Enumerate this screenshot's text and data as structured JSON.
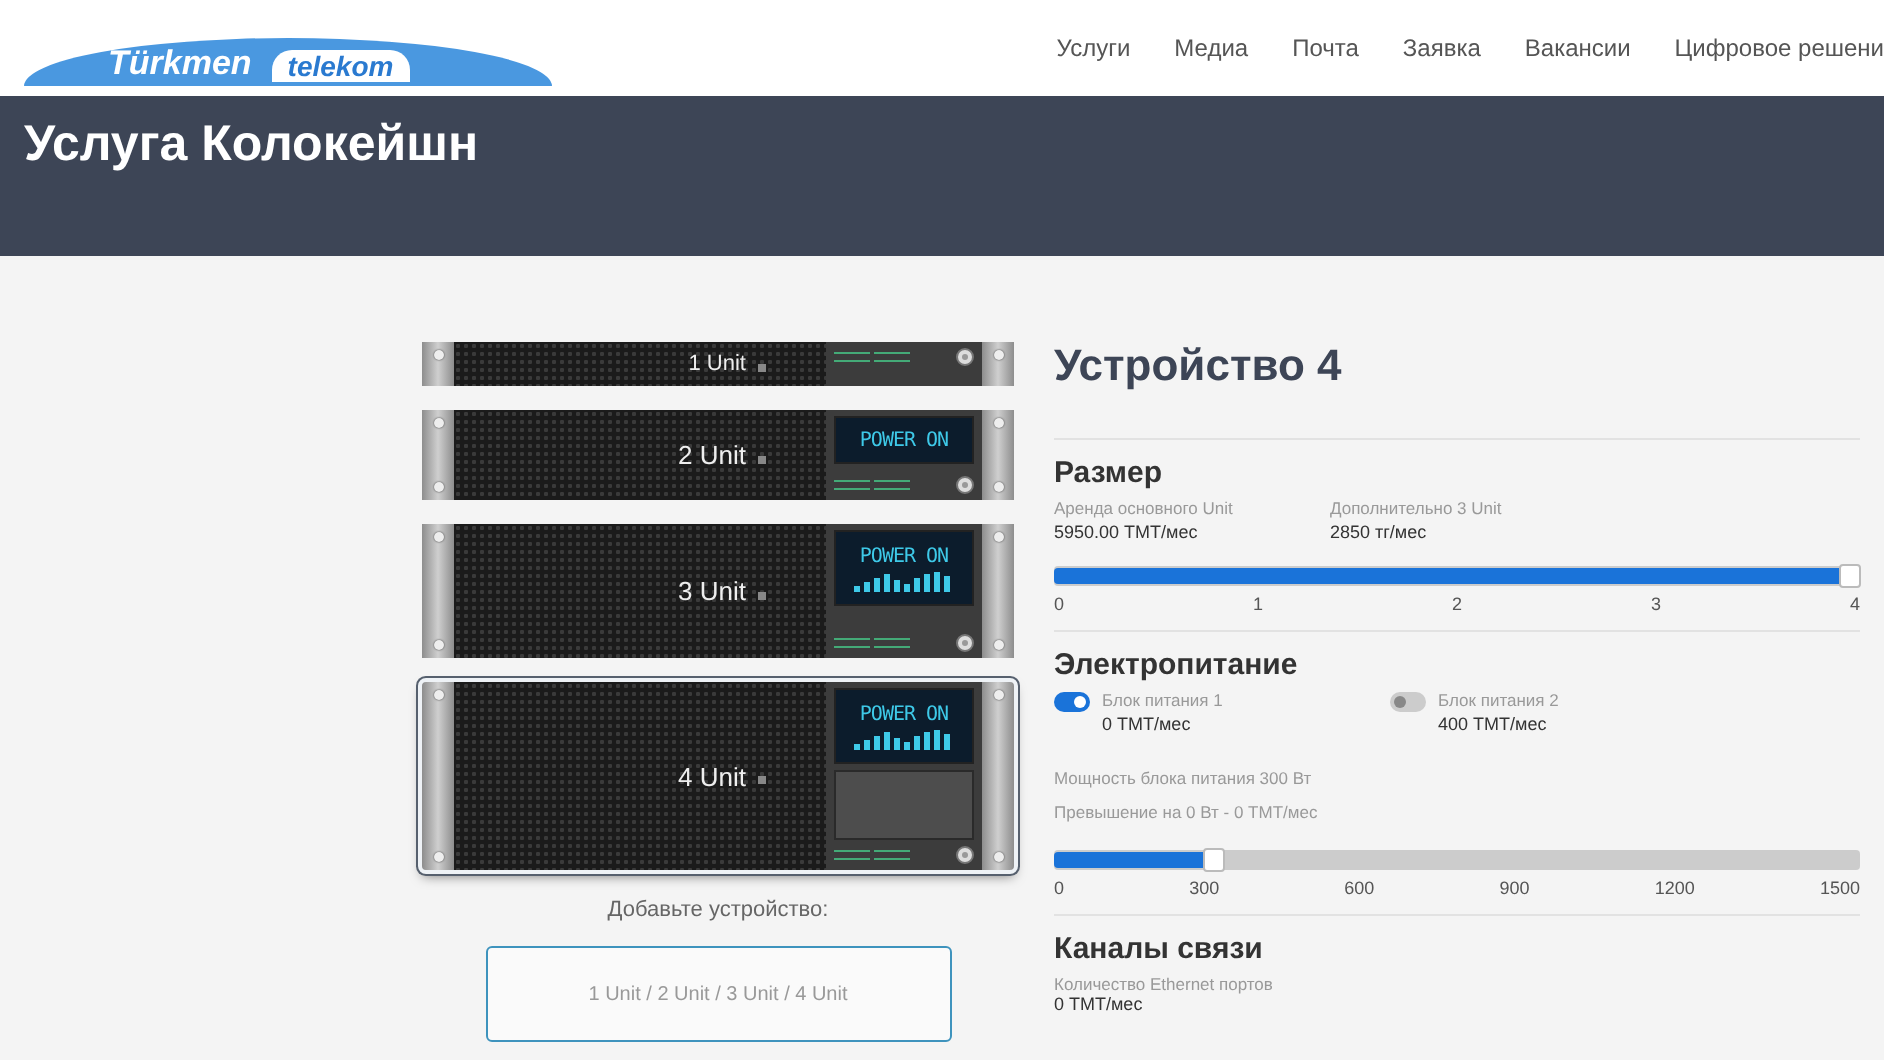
{
  "header": {
    "logo": {
      "word_1": "Türkmen",
      "word_2": "telekom"
    },
    "nav": [
      "Услуги",
      "Медиа",
      "Почта",
      "Заявка",
      "Вакансии",
      "Цифровое решени"
    ]
  },
  "banner": {
    "title": "Услуга Колокейшн"
  },
  "devices": [
    {
      "label": "1 Unit",
      "kind": "single",
      "selected": false
    },
    {
      "label": "2 Unit",
      "kind": "double",
      "selected": false,
      "display": {
        "text": "POWER ON",
        "bars": false
      }
    },
    {
      "label": "3 Unit",
      "kind": "triple",
      "selected": false,
      "display": {
        "text": "POWER ON",
        "bars": true
      }
    },
    {
      "label": "4 Unit",
      "kind": "quad",
      "selected": true,
      "display": {
        "text": "POWER ON",
        "bars": true
      }
    }
  ],
  "add_device": {
    "prompt": "Добавьте устройство:",
    "options": "1 Unit / 2 Unit / 3 Unit / 4 Unit"
  },
  "config": {
    "title": "Устройство 4",
    "size": {
      "title": "Размер",
      "info": [
        {
          "label": "Аренда основного Unit",
          "value": "5950.00 ТМТ/мес"
        },
        {
          "label": "Дополнительно 3 Unit",
          "value": "2850 тг/мес"
        }
      ],
      "slider": {
        "level": 1,
        "ticks": [
          "0",
          "1",
          "2",
          "3",
          "4"
        ]
      }
    },
    "power": {
      "title": "Электропитание",
      "supplies": [
        {
          "label": "Блок питания 1",
          "price": "0 ТМТ/мес",
          "on": true
        },
        {
          "label": "Блок питания 2",
          "price": "400 ТМТ/мес",
          "on": false
        }
      ],
      "notes": [
        "Мощность блока питания 300 Вт",
        "Превышение на 0 Вт - 0 ТМТ/мес"
      ],
      "slider": {
        "level": 0.2,
        "ticks": [
          "0",
          "300",
          "600",
          "900",
          "1200",
          "1500"
        ]
      }
    },
    "channels": {
      "title": "Каналы связи",
      "label": "Количество Ethernet портов",
      "value": "0 ТМТ/мес"
    }
  }
}
